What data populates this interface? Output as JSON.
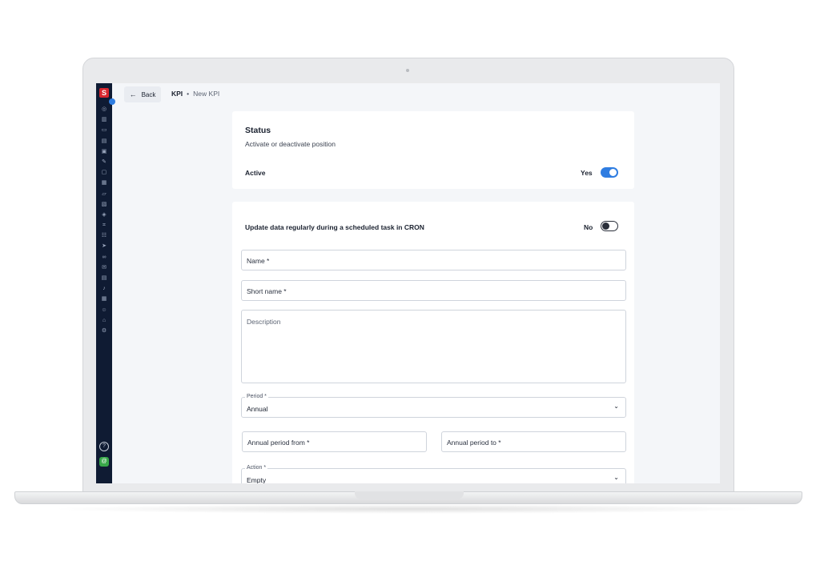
{
  "nav": {
    "back_label": "Back",
    "breadcrumb_root": "KPI",
    "breadcrumb_separator": "•",
    "breadcrumb_current": "New KPI"
  },
  "sidebar": {
    "logo_letter": "S",
    "icons": [
      "dashboard-icon",
      "chart-icon",
      "presentation-icon",
      "document-icon",
      "image-icon",
      "edit-icon",
      "clipboard-icon",
      "calendar-icon",
      "folder-icon",
      "gallery-icon",
      "tag-icon",
      "network-icon",
      "team-icon",
      "send-icon",
      "link-icon",
      "mail-icon",
      "database-icon",
      "bell-icon",
      "calculator-icon",
      "users-icon",
      "graduation-icon",
      "settings-icon"
    ],
    "help_glyph": "?",
    "user_glyph": "@"
  },
  "status_card": {
    "title": "Status",
    "subtitle": "Activate or deactivate position",
    "active_label": "Active",
    "active_value": "Yes",
    "active_on": true
  },
  "form": {
    "cron_label": "Update data regularly during a scheduled task in CRON",
    "cron_value": "No",
    "cron_on": false,
    "name_placeholder": "Name *",
    "short_name_placeholder": "Short name *",
    "description_placeholder": "Description",
    "period_label": "Period *",
    "period_value": "Annual",
    "annual_from_placeholder": "Annual period from *",
    "annual_to_placeholder": "Annual period to  *",
    "action_label": "Action *",
    "action_value": "Empty"
  },
  "chevron_glyph": "⌄",
  "colors": {
    "sidebar_bg": "#0f1b33",
    "brand_red": "#d7262e",
    "toggle_on": "#2f7de1",
    "page_bg": "#f4f6f9"
  }
}
